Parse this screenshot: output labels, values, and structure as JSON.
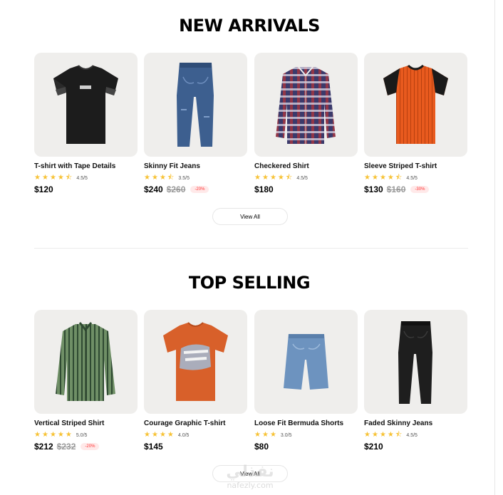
{
  "new_arrivals": {
    "title": "NEW ARRIVALS",
    "view_all": "View All",
    "products": [
      {
        "name": "T-shirt with Tape Details",
        "rating": 4.5,
        "rating_text": "4.5/5",
        "price": "$120",
        "old_price": "",
        "discount": "",
        "icon": "black-tshirt-icon"
      },
      {
        "name": "Skinny Fit Jeans",
        "rating": 3.5,
        "rating_text": "3.5/5",
        "price": "$240",
        "old_price": "$260",
        "discount": "-20%",
        "icon": "blue-jeans-icon"
      },
      {
        "name": "Checkered Shirt",
        "rating": 4.5,
        "rating_text": "4.5/5",
        "price": "$180",
        "old_price": "",
        "discount": "",
        "icon": "checkered-shirt-icon"
      },
      {
        "name": "Sleeve Striped T-shirt",
        "rating": 4.5,
        "rating_text": "4.5/5",
        "price": "$130",
        "old_price": "$160",
        "discount": "-30%",
        "icon": "striped-tshirt-icon"
      }
    ]
  },
  "top_selling": {
    "title": "TOP SELLING",
    "view_all": "View All",
    "products": [
      {
        "name": "Vertical Striped Shirt",
        "rating": 5.0,
        "rating_text": "5.0/5",
        "price": "$212",
        "old_price": "$232",
        "discount": "-20%",
        "icon": "green-striped-shirt-icon"
      },
      {
        "name": "Courage Graphic T-shirt",
        "rating": 4.0,
        "rating_text": "4.0/5",
        "price": "$145",
        "old_price": "",
        "discount": "",
        "icon": "orange-graphic-tshirt-icon"
      },
      {
        "name": "Loose Fit Bermuda Shorts",
        "rating": 3.0,
        "rating_text": "3.0/5",
        "price": "$80",
        "old_price": "",
        "discount": "",
        "icon": "denim-shorts-icon"
      },
      {
        "name": "Faded Skinny Jeans",
        "rating": 4.5,
        "rating_text": "4.5/5",
        "price": "$210",
        "old_price": "",
        "discount": "",
        "icon": "black-jeans-icon"
      }
    ]
  },
  "watermark": {
    "arabic": "نفذلي",
    "latin": "nafezly.com"
  },
  "colors": {
    "star": "#f7c234",
    "discount_text": "#ff3333",
    "discount_bg": "#ffe9e9",
    "card_bg": "#efeeec"
  }
}
